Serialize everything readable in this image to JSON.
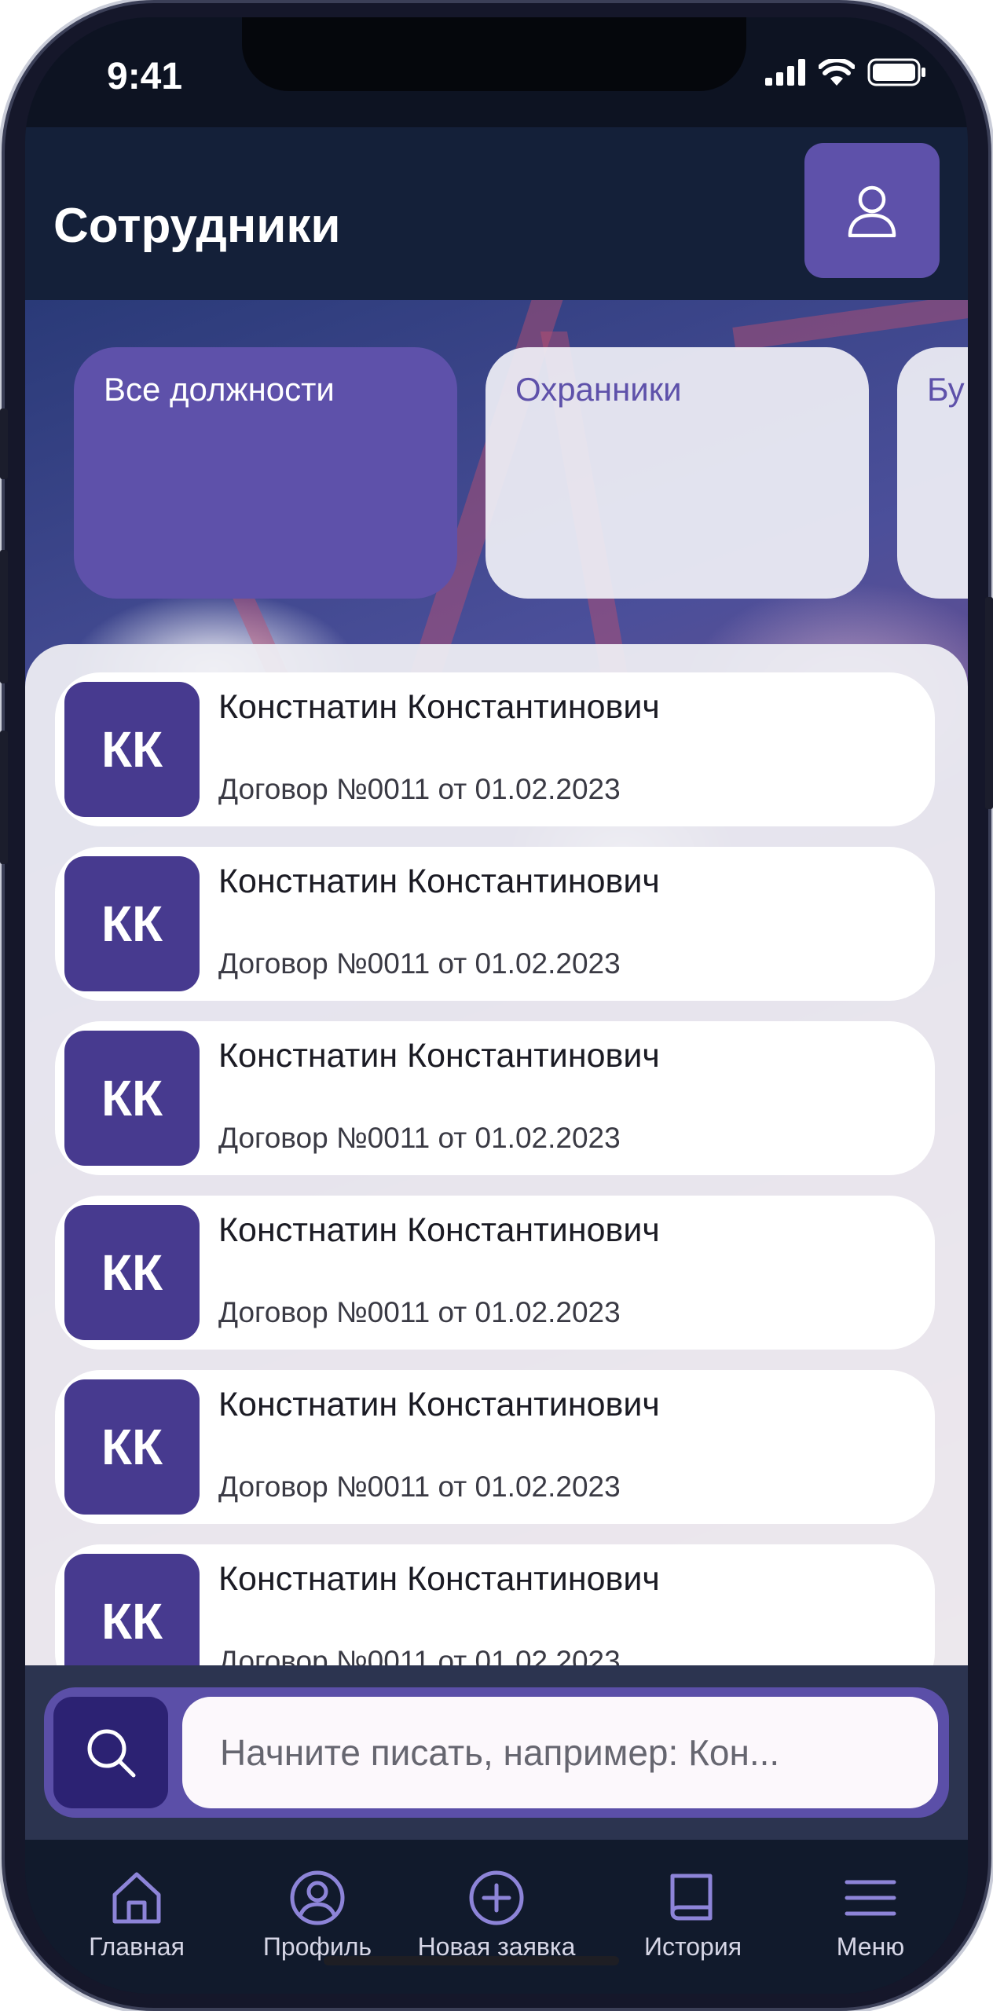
{
  "status_bar": {
    "time": "9:41"
  },
  "header": {
    "title": "Сотрудники"
  },
  "filters": [
    {
      "label": "Все должности",
      "active": true
    },
    {
      "label": "Охранники",
      "active": false
    },
    {
      "label": "Бу",
      "active": false
    }
  ],
  "employees": [
    {
      "initials": "КК",
      "name": "Констнатин Константинович",
      "contract": "Договор №0011 от 01.02.2023"
    },
    {
      "initials": "КК",
      "name": "Констнатин Константинович",
      "contract": "Договор №0011 от 01.02.2023"
    },
    {
      "initials": "КК",
      "name": "Констнатин Константинович",
      "contract": "Договор №0011 от 01.02.2023"
    },
    {
      "initials": "КК",
      "name": "Констнатин Константинович",
      "contract": "Договор №0011 от 01.02.2023"
    },
    {
      "initials": "КК",
      "name": "Констнатин Константинович",
      "contract": "Договор №0011 от 01.02.2023"
    },
    {
      "initials": "КК",
      "name": "Констнатин Константинович",
      "contract": "Договор №0011 от 01.02.2023"
    }
  ],
  "search": {
    "placeholder": "Начните писать, например: Кон..."
  },
  "nav": [
    {
      "label": "Главная",
      "icon": "home-icon"
    },
    {
      "label": "Профиль",
      "icon": "profile-icon"
    },
    {
      "label": "Новая заявка",
      "icon": "plus-circle-icon"
    },
    {
      "label": "История",
      "icon": "book-icon"
    },
    {
      "label": "Меню",
      "icon": "menu-icon"
    }
  ],
  "colors": {
    "accent": "#5e51aa",
    "avatar": "#473a8f",
    "header_bg": "#142039",
    "nav_bg": "#111a2c"
  }
}
